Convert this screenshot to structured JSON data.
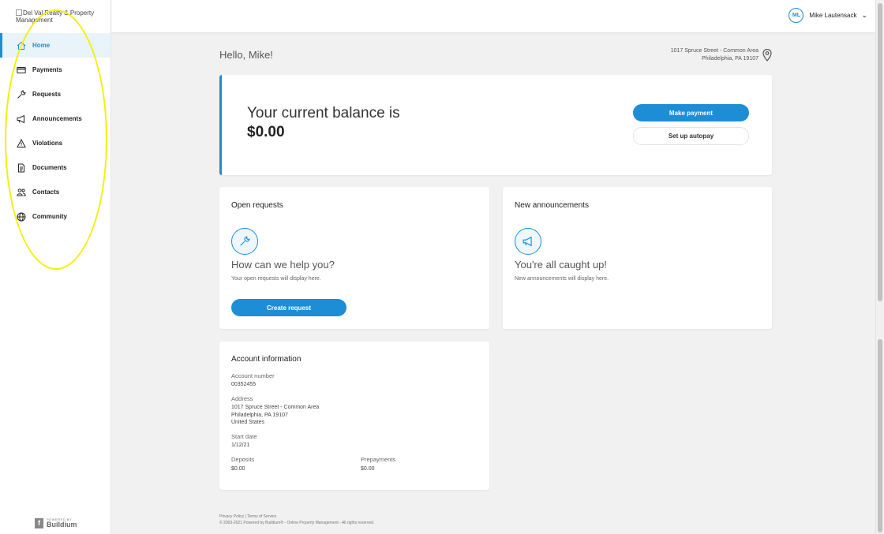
{
  "sidebar": {
    "logo_alt": "Del Val Realty & Property Management",
    "items": [
      {
        "label": "Home"
      },
      {
        "label": "Payments"
      },
      {
        "label": "Requests"
      },
      {
        "label": "Announcements"
      },
      {
        "label": "Violations"
      },
      {
        "label": "Documents"
      },
      {
        "label": "Contacts"
      },
      {
        "label": "Community"
      }
    ],
    "powered_by": "POWERED BY",
    "powered_brand": "Buildium"
  },
  "header": {
    "user_initials": "ML",
    "user_name": "Mike Lautensack"
  },
  "main": {
    "greeting": "Hello, Mike!",
    "property_line1": "1017 Spruce Street - Common Area",
    "property_line2": "Philadelphia, PA 19107",
    "balance": {
      "label": "Your current balance is",
      "amount": "$0.00",
      "make_payment": "Make payment",
      "autopay": "Set up autopay"
    },
    "requests": {
      "title": "Open requests",
      "heading": "How can we help you?",
      "sub": "Your open requests will display here.",
      "button": "Create request"
    },
    "announcements": {
      "title": "New announcements",
      "heading": "You're all caught up!",
      "sub": "New announcements will display here."
    },
    "account": {
      "title": "Account information",
      "number_label": "Account number",
      "number": "00352455",
      "address_label": "Address",
      "address_line1": "1017 Spruce Street - Common Area",
      "address_line2": "Philadelphia, PA 19107",
      "address_line3": "United States",
      "start_label": "Start date",
      "start": "1/12/21",
      "deposits_label": "Deposits",
      "deposits": "$0.00",
      "prepayments_label": "Prepayments",
      "prepayments": "$0.00"
    }
  },
  "footer": {
    "links": "Privacy Policy | Terms of Service",
    "copyright": "© 2003-2021 Powered by Buildium® - Online Property Management - All rights reserved."
  },
  "colors": {
    "accent": "#1d8ed6",
    "highlight": "#f4f00a"
  }
}
